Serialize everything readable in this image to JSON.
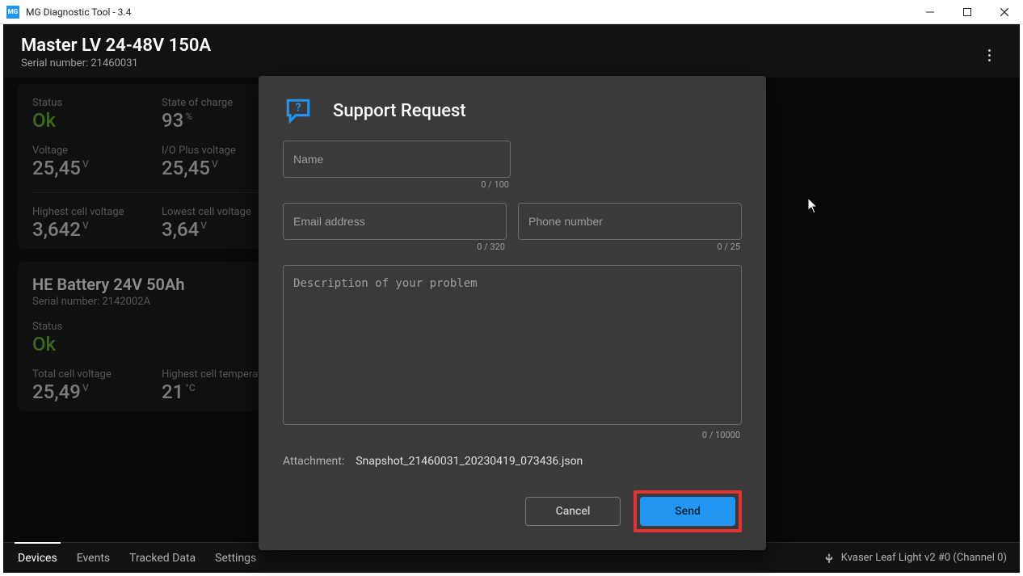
{
  "window": {
    "app_badge": "MG",
    "title": "MG Diagnostic Tool - 3.4"
  },
  "header": {
    "title": "Master LV 24-48V 150A",
    "serial_label": "Serial number:",
    "serial_value": "21460031"
  },
  "master_card": {
    "status_label": "Status",
    "status_value": "Ok",
    "soc_label": "State of charge",
    "soc_value": "93",
    "soc_unit": "%",
    "voltage_label": "Voltage",
    "voltage_value": "25,45",
    "voltage_unit": "V",
    "ioplus_label": "I/O Plus voltage",
    "ioplus_value": "25,45",
    "ioplus_unit": "V",
    "hcell_label": "Highest cell voltage",
    "hcell_value": "3,642",
    "hcell_unit": "V",
    "lcell_label": "Lowest cell voltage",
    "lcell_value": "3,64",
    "lcell_unit": "V"
  },
  "battery_card": {
    "title": "HE Battery 24V 50Ah",
    "serial_label": "Serial number:",
    "serial_value": "2142002A",
    "status_label": "Status",
    "status_value": "Ok",
    "tcv_label": "Total cell voltage",
    "tcv_value": "25,49",
    "tcv_unit": "V",
    "hct_label": "Highest cell temperature",
    "hct_value": "21",
    "hct_unit": "°C"
  },
  "tabs": {
    "devices": "Devices",
    "events": "Events",
    "tracked": "Tracked Data",
    "settings": "Settings"
  },
  "usb_status": "Kvaser Leaf Light v2 #0 (Channel 0)",
  "dialog": {
    "title": "Support Request",
    "name_placeholder": "Name",
    "name_counter": "0 / 100",
    "email_placeholder": "Email address",
    "email_counter": "0 / 320",
    "phone_placeholder": "Phone number",
    "phone_counter": "0 / 25",
    "desc_placeholder": "Description of your problem",
    "desc_counter": "0 / 10000",
    "attachment_label": "Attachment:",
    "attachment_file": "Snapshot_21460031_20230419_073436.json",
    "cancel": "Cancel",
    "send": "Send"
  }
}
